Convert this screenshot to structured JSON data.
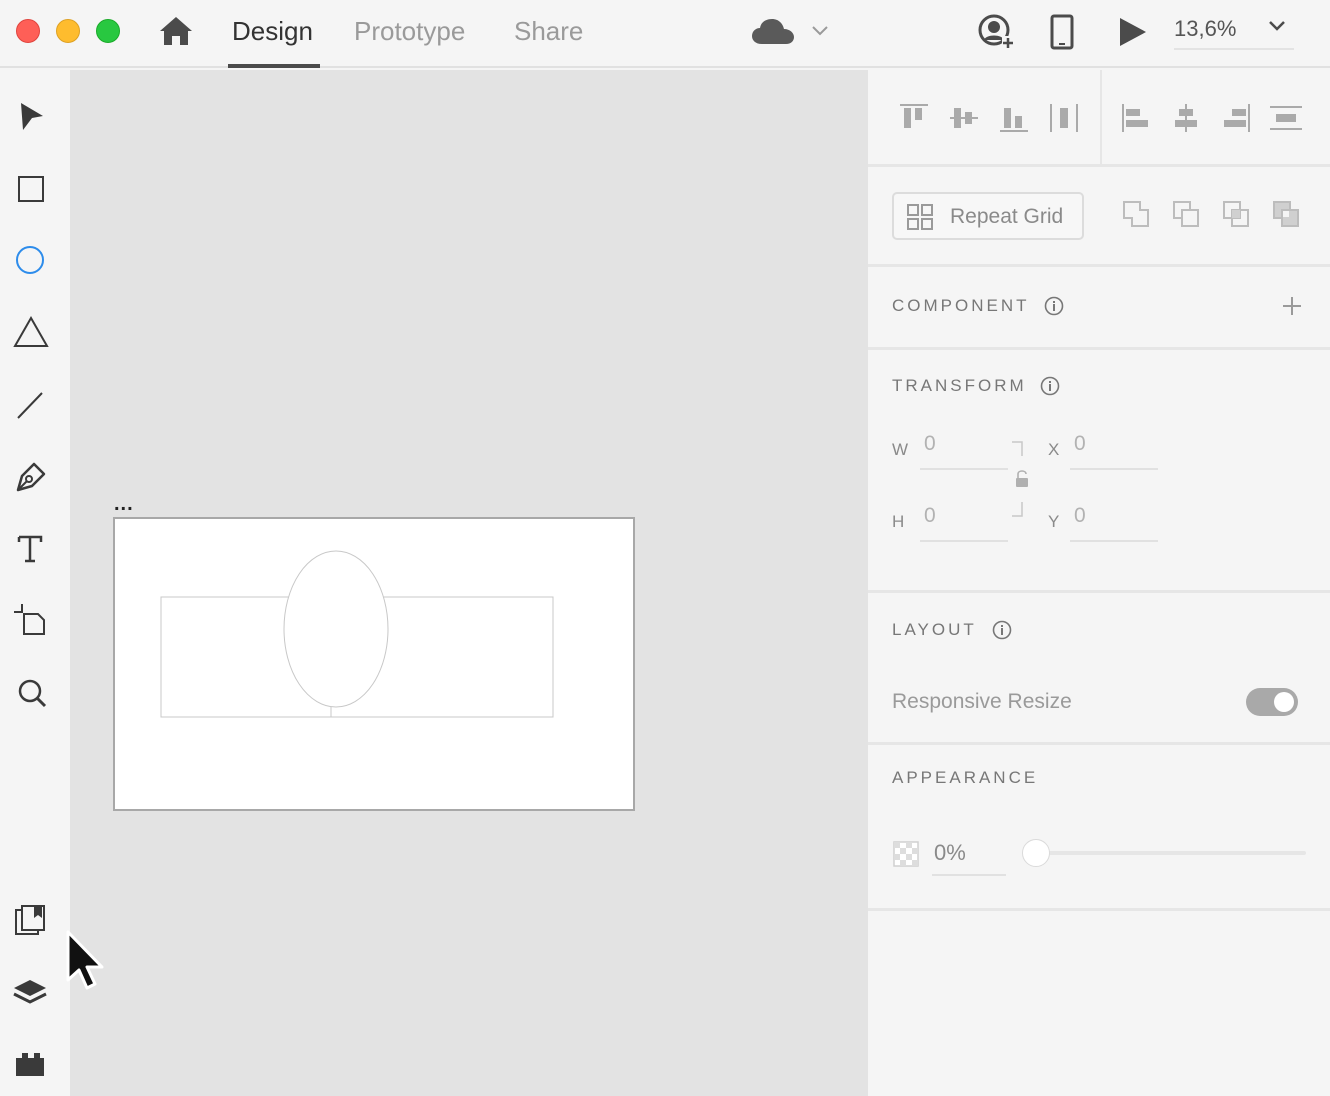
{
  "tabs": [
    {
      "label": "Design",
      "active": true
    },
    {
      "label": "Prototype",
      "active": false
    },
    {
      "label": "Share",
      "active": false
    }
  ],
  "zoom": {
    "value": "13,6%"
  },
  "artboard": {
    "label": "..."
  },
  "panel": {
    "repeat_grid": {
      "label": "Repeat Grid"
    },
    "component": {
      "title": "COMPONENT"
    },
    "transform": {
      "title": "TRANSFORM",
      "w_label": "W",
      "w_value": "0",
      "h_label": "H",
      "h_value": "0",
      "x_label": "X",
      "x_value": "0",
      "y_label": "Y",
      "y_value": "0"
    },
    "layout": {
      "title": "LAYOUT",
      "responsive_resize_label": "Responsive Resize",
      "responsive_resize_on": true
    },
    "appearance": {
      "title": "APPEARANCE",
      "opacity_value": "0%",
      "opacity_fraction": 0
    }
  },
  "icons": {
    "toolbar": [
      "select-icon",
      "rectangle-icon",
      "ellipse-icon",
      "polygon-icon",
      "line-icon",
      "pen-icon",
      "text-icon",
      "artboard-icon",
      "zoom-icon",
      "assets-icon",
      "layers-icon",
      "plugins-icon"
    ],
    "active_tool": "ellipse-icon"
  },
  "colors": {
    "accent": "#2d8ceb",
    "close": "#fe5f57",
    "minimize": "#febc2e",
    "maximize": "#28c840"
  }
}
